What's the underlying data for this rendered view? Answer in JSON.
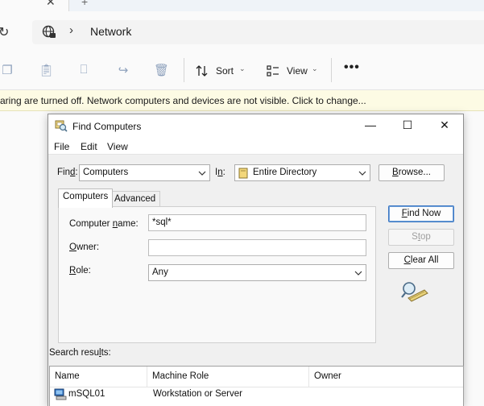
{
  "explorer": {
    "tab_close_glyph": "✕",
    "tab_new_glyph": "+",
    "breadcrumb": "Network",
    "toolbar": {
      "sort_label": "Sort",
      "view_label": "View",
      "more_glyph": "•••"
    },
    "infobar_text": "aring are turned off. Network computers and devices are not visible. Click to change..."
  },
  "dialog": {
    "title": "Find Computers",
    "window_buttons": {
      "minimize": "—",
      "maximize": "☐",
      "close": "✕"
    },
    "menu": [
      "File",
      "Edit",
      "View"
    ],
    "find_label_pre": "Fin",
    "find_label_acc": "d",
    "find_label_post": ":",
    "find_value": "Computers",
    "in_label_pre": "I",
    "in_label_acc": "n",
    "in_label_post": ":",
    "in_value": "Entire Directory",
    "browse_label_pre": "",
    "browse_label_acc": "B",
    "browse_label_post": "rowse...",
    "tabs": [
      "Computers",
      "Advanced"
    ],
    "computer_name_label_pre": "Computer ",
    "computer_name_label_acc": "n",
    "computer_name_label_post": "ame:",
    "computer_name_value": "*sql*",
    "owner_label_pre": "",
    "owner_label_acc": "O",
    "owner_label_post": "wner:",
    "owner_value": "",
    "role_label_pre": "",
    "role_label_acc": "R",
    "role_label_post": "ole:",
    "role_value": "Any",
    "find_now_pre": "",
    "find_now_acc": "F",
    "find_now_post": "ind Now",
    "stop_pre": "S",
    "stop_acc": "t",
    "stop_post": "op",
    "clear_all_pre": "",
    "clear_all_acc": "C",
    "clear_all_post": "lear All",
    "search_results_pre": "Search resu",
    "search_results_acc": "l",
    "search_results_post": "ts:",
    "results": {
      "columns": [
        "Name",
        "Machine Role",
        "Owner"
      ],
      "rows": [
        {
          "name": "mSQL01",
          "role": "Workstation or Server",
          "owner": ""
        }
      ]
    }
  }
}
